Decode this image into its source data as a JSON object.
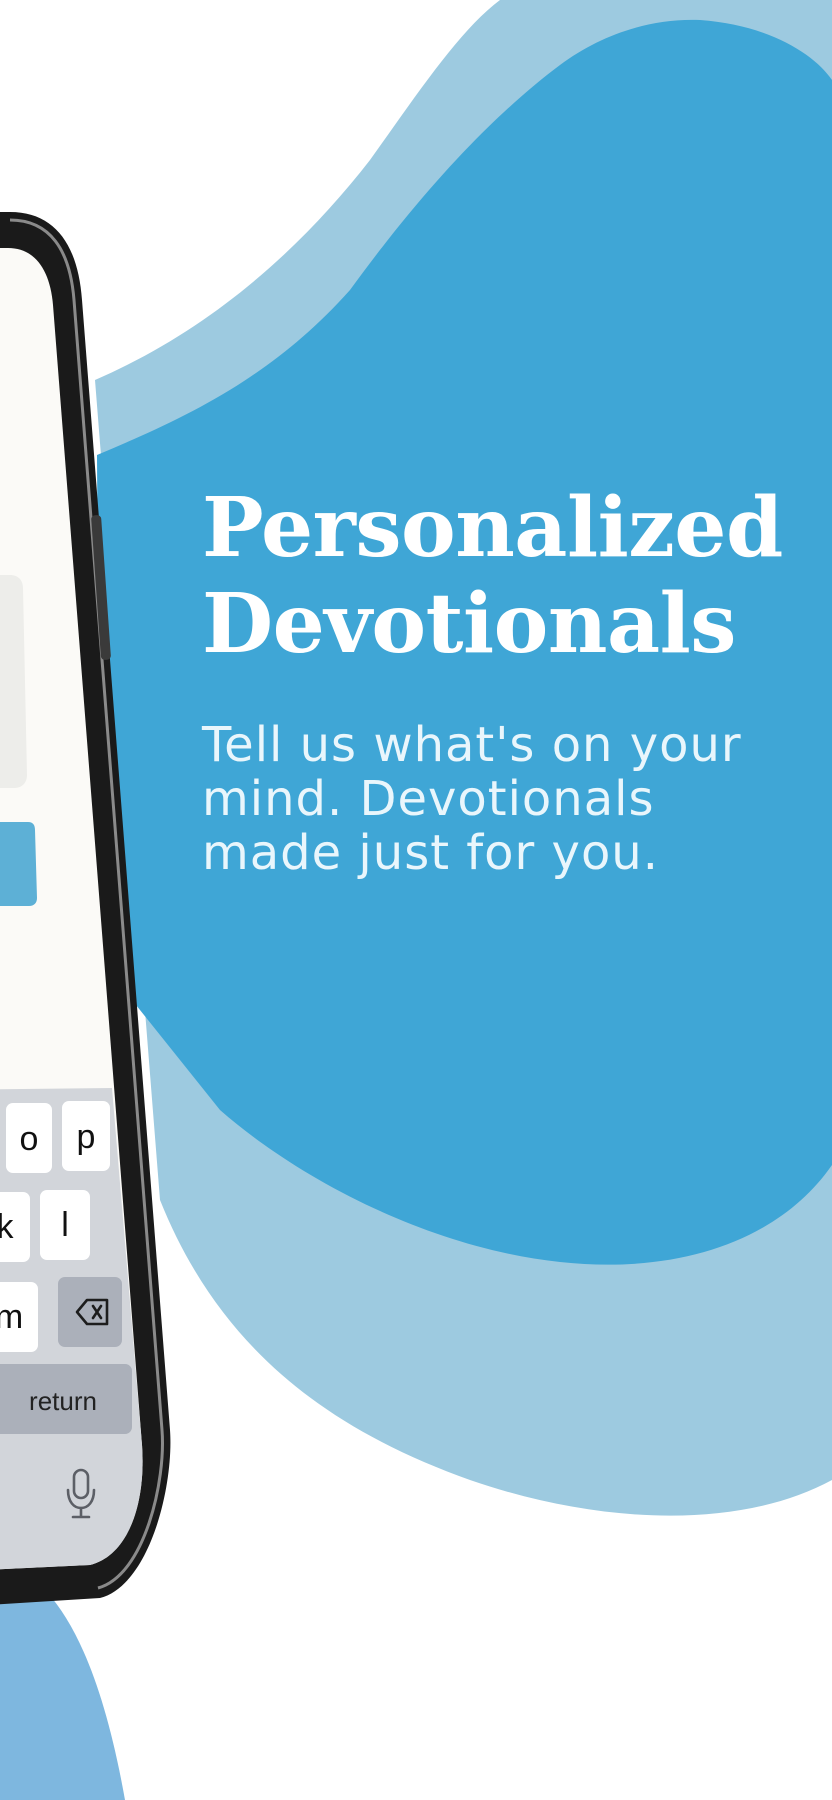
{
  "promo": {
    "headline_line1": "Personalized",
    "headline_line2": "Devotionals",
    "subtext_line1": "Tell us what's on your",
    "subtext_line2": "mind. Devotionals",
    "subtext_line3": "made just for you."
  },
  "keyboard": {
    "row1": [
      "o",
      "p"
    ],
    "row2": [
      "k",
      "l"
    ],
    "row3": [
      "m"
    ],
    "return_label": "return"
  },
  "icons": {
    "delete": "backspace-icon",
    "dictation": "microphone-icon"
  },
  "colors": {
    "blob_primary": "#3FA6D6",
    "blob_secondary": "#9DCAE0",
    "blob_bottom": "#7EB7DF",
    "headline": "#FFFFFF",
    "subtext": "#E9F6FC",
    "phone_screen": "#FBFAF7",
    "keyboard_bg": "#D2D5DA",
    "accent_button": "#5DB0D6"
  }
}
